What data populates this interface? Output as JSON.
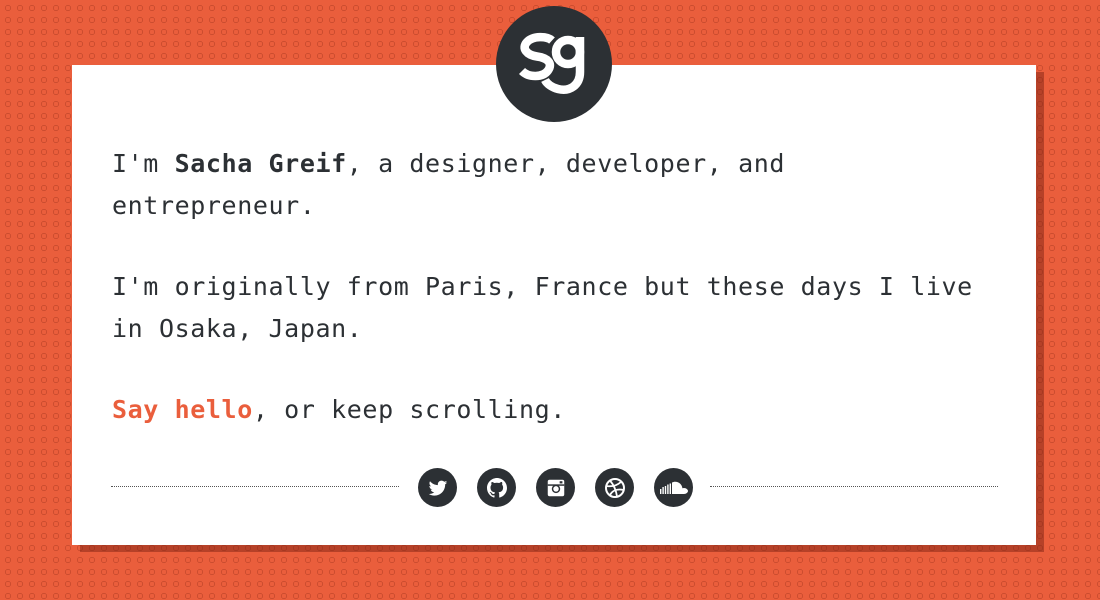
{
  "logo": {
    "text": "sg",
    "icon": "sg-monogram-logo"
  },
  "intro": {
    "prefix": "I'm ",
    "name": "Sacha Greif",
    "suffix": ", a designer, developer, and entrepreneur."
  },
  "location": {
    "text": "I'm originally from Paris, France but these days I live in Osaka, Japan."
  },
  "cta": {
    "link_text": "Say hello",
    "rest": ", or keep scrolling."
  },
  "socials": [
    {
      "name": "twitter-icon"
    },
    {
      "name": "github-icon"
    },
    {
      "name": "instagram-icon"
    },
    {
      "name": "dribbble-icon"
    },
    {
      "name": "soundcloud-icon"
    }
  ],
  "colors": {
    "accent": "#ea5e3c",
    "dark": "#2c3034",
    "card": "#ffffff"
  }
}
